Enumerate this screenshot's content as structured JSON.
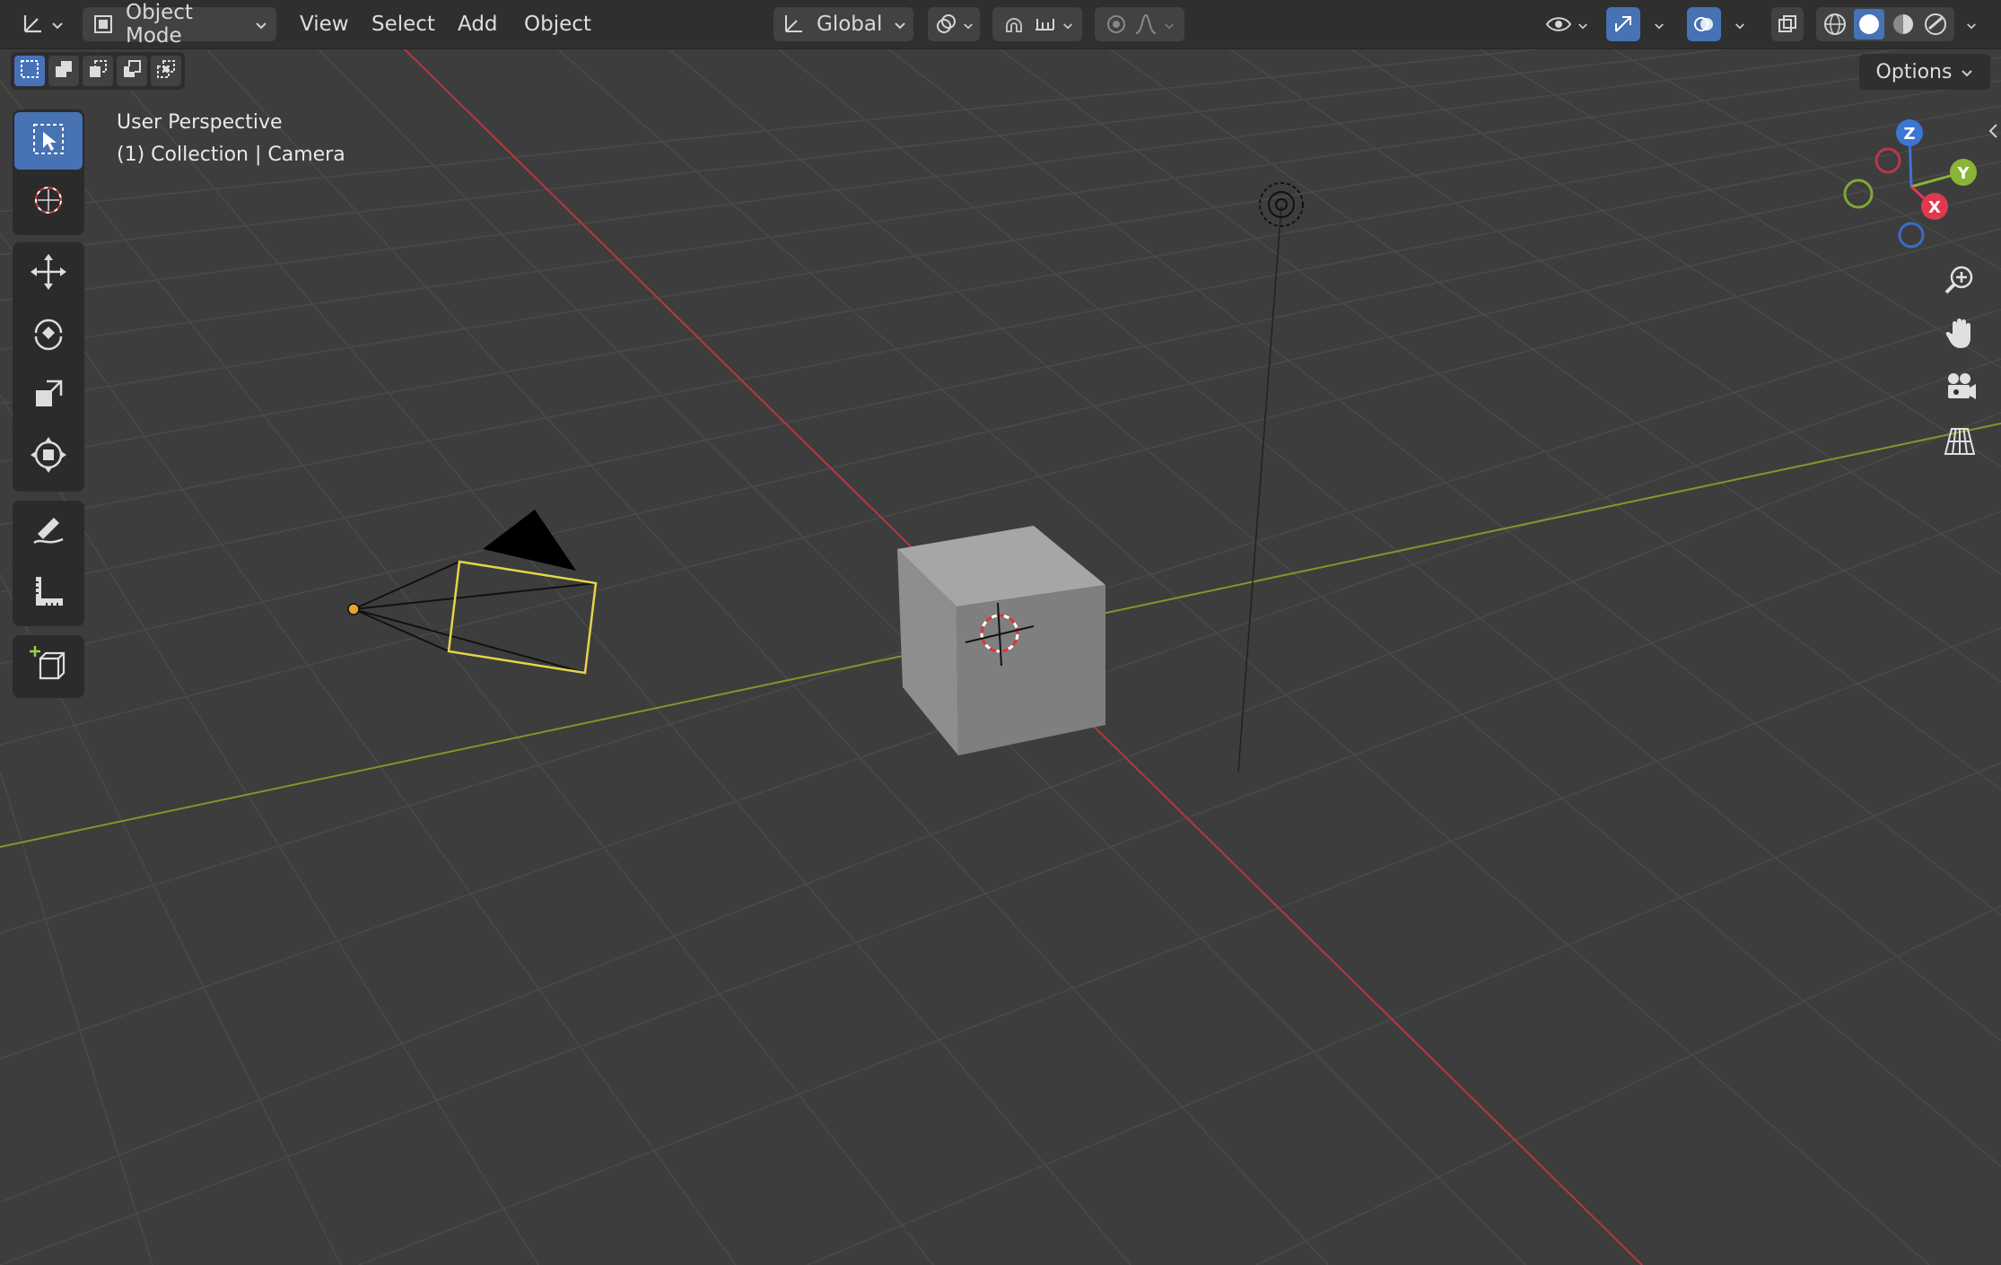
{
  "header": {
    "mode_label": "Object Mode",
    "menus": [
      "View",
      "Select",
      "Add",
      "Object"
    ],
    "transform_orientation": "Global"
  },
  "options_label": "Options",
  "viewport": {
    "view_name": "User Perspective",
    "collection_info": "(1) Collection | Camera"
  },
  "gizmo": {
    "z_label": "Z",
    "y_label": "Y",
    "x_label": "X",
    "colors": {
      "x": "#e0394f",
      "y": "#8ab437",
      "z": "#3c76d3"
    }
  },
  "colors": {
    "background": "#3d3d3d",
    "header": "#2f2f2f",
    "active_tool": "#4772b3",
    "x_axis": "#b8383f",
    "y_axis": "#7a9a2a",
    "camera_selected": "#e7d34a"
  }
}
